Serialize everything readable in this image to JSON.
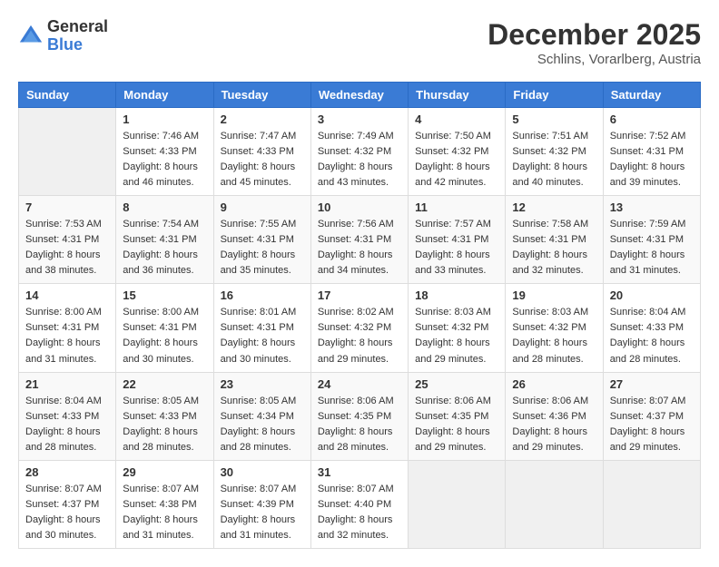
{
  "header": {
    "logo_general": "General",
    "logo_blue": "Blue",
    "month_year": "December 2025",
    "location": "Schlins, Vorarlberg, Austria"
  },
  "days_of_week": [
    "Sunday",
    "Monday",
    "Tuesday",
    "Wednesday",
    "Thursday",
    "Friday",
    "Saturday"
  ],
  "weeks": [
    [
      {
        "day": "",
        "info": ""
      },
      {
        "day": "1",
        "info": "Sunrise: 7:46 AM\nSunset: 4:33 PM\nDaylight: 8 hours\nand 46 minutes."
      },
      {
        "day": "2",
        "info": "Sunrise: 7:47 AM\nSunset: 4:33 PM\nDaylight: 8 hours\nand 45 minutes."
      },
      {
        "day": "3",
        "info": "Sunrise: 7:49 AM\nSunset: 4:32 PM\nDaylight: 8 hours\nand 43 minutes."
      },
      {
        "day": "4",
        "info": "Sunrise: 7:50 AM\nSunset: 4:32 PM\nDaylight: 8 hours\nand 42 minutes."
      },
      {
        "day": "5",
        "info": "Sunrise: 7:51 AM\nSunset: 4:32 PM\nDaylight: 8 hours\nand 40 minutes."
      },
      {
        "day": "6",
        "info": "Sunrise: 7:52 AM\nSunset: 4:31 PM\nDaylight: 8 hours\nand 39 minutes."
      }
    ],
    [
      {
        "day": "7",
        "info": "Sunrise: 7:53 AM\nSunset: 4:31 PM\nDaylight: 8 hours\nand 38 minutes."
      },
      {
        "day": "8",
        "info": "Sunrise: 7:54 AM\nSunset: 4:31 PM\nDaylight: 8 hours\nand 36 minutes."
      },
      {
        "day": "9",
        "info": "Sunrise: 7:55 AM\nSunset: 4:31 PM\nDaylight: 8 hours\nand 35 minutes."
      },
      {
        "day": "10",
        "info": "Sunrise: 7:56 AM\nSunset: 4:31 PM\nDaylight: 8 hours\nand 34 minutes."
      },
      {
        "day": "11",
        "info": "Sunrise: 7:57 AM\nSunset: 4:31 PM\nDaylight: 8 hours\nand 33 minutes."
      },
      {
        "day": "12",
        "info": "Sunrise: 7:58 AM\nSunset: 4:31 PM\nDaylight: 8 hours\nand 32 minutes."
      },
      {
        "day": "13",
        "info": "Sunrise: 7:59 AM\nSunset: 4:31 PM\nDaylight: 8 hours\nand 31 minutes."
      }
    ],
    [
      {
        "day": "14",
        "info": "Sunrise: 8:00 AM\nSunset: 4:31 PM\nDaylight: 8 hours\nand 31 minutes."
      },
      {
        "day": "15",
        "info": "Sunrise: 8:00 AM\nSunset: 4:31 PM\nDaylight: 8 hours\nand 30 minutes."
      },
      {
        "day": "16",
        "info": "Sunrise: 8:01 AM\nSunset: 4:31 PM\nDaylight: 8 hours\nand 30 minutes."
      },
      {
        "day": "17",
        "info": "Sunrise: 8:02 AM\nSunset: 4:32 PM\nDaylight: 8 hours\nand 29 minutes."
      },
      {
        "day": "18",
        "info": "Sunrise: 8:03 AM\nSunset: 4:32 PM\nDaylight: 8 hours\nand 29 minutes."
      },
      {
        "day": "19",
        "info": "Sunrise: 8:03 AM\nSunset: 4:32 PM\nDaylight: 8 hours\nand 28 minutes."
      },
      {
        "day": "20",
        "info": "Sunrise: 8:04 AM\nSunset: 4:33 PM\nDaylight: 8 hours\nand 28 minutes."
      }
    ],
    [
      {
        "day": "21",
        "info": "Sunrise: 8:04 AM\nSunset: 4:33 PM\nDaylight: 8 hours\nand 28 minutes."
      },
      {
        "day": "22",
        "info": "Sunrise: 8:05 AM\nSunset: 4:33 PM\nDaylight: 8 hours\nand 28 minutes."
      },
      {
        "day": "23",
        "info": "Sunrise: 8:05 AM\nSunset: 4:34 PM\nDaylight: 8 hours\nand 28 minutes."
      },
      {
        "day": "24",
        "info": "Sunrise: 8:06 AM\nSunset: 4:35 PM\nDaylight: 8 hours\nand 28 minutes."
      },
      {
        "day": "25",
        "info": "Sunrise: 8:06 AM\nSunset: 4:35 PM\nDaylight: 8 hours\nand 29 minutes."
      },
      {
        "day": "26",
        "info": "Sunrise: 8:06 AM\nSunset: 4:36 PM\nDaylight: 8 hours\nand 29 minutes."
      },
      {
        "day": "27",
        "info": "Sunrise: 8:07 AM\nSunset: 4:37 PM\nDaylight: 8 hours\nand 29 minutes."
      }
    ],
    [
      {
        "day": "28",
        "info": "Sunrise: 8:07 AM\nSunset: 4:37 PM\nDaylight: 8 hours\nand 30 minutes."
      },
      {
        "day": "29",
        "info": "Sunrise: 8:07 AM\nSunset: 4:38 PM\nDaylight: 8 hours\nand 31 minutes."
      },
      {
        "day": "30",
        "info": "Sunrise: 8:07 AM\nSunset: 4:39 PM\nDaylight: 8 hours\nand 31 minutes."
      },
      {
        "day": "31",
        "info": "Sunrise: 8:07 AM\nSunset: 4:40 PM\nDaylight: 8 hours\nand 32 minutes."
      },
      {
        "day": "",
        "info": ""
      },
      {
        "day": "",
        "info": ""
      },
      {
        "day": "",
        "info": ""
      }
    ]
  ]
}
